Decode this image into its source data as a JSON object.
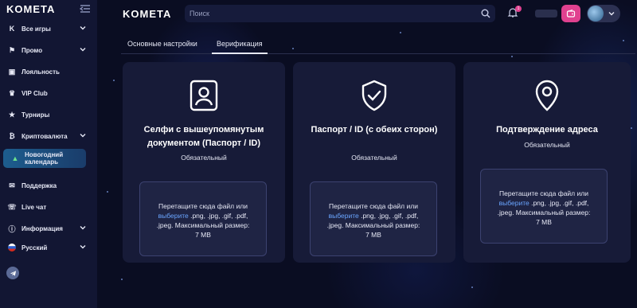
{
  "sidebar": {
    "logo_main": "KOMETA",
    "items": [
      {
        "label": "Все игры",
        "icon": "kometa-icon"
      },
      {
        "label": "Промо",
        "icon": "megaphone-icon"
      },
      {
        "label": "Лояльность",
        "icon": "loyalty-icon"
      },
      {
        "label": "VIP Club",
        "icon": "crown-icon"
      },
      {
        "label": "Турниры",
        "icon": "trophy-icon"
      },
      {
        "label": "Криптовалюта",
        "icon": "crypto-icon"
      },
      {
        "label": "Новогодний календарь",
        "icon": "tree-icon"
      },
      {
        "label": "Поддержка",
        "icon": "support-icon"
      },
      {
        "label": "Live чат",
        "icon": "headset-icon"
      },
      {
        "label": "Информация",
        "icon": "info-icon"
      },
      {
        "label": "Русский",
        "icon": "russian-flag-icon"
      }
    ]
  },
  "header": {
    "logo": "KOMETA",
    "search_placeholder": "Поиск",
    "notifications_count": "1"
  },
  "tabs": [
    {
      "label": "Основные настройки",
      "active": false
    },
    {
      "label": "Верификация",
      "active": true
    }
  ],
  "cards": [
    {
      "title": "Селфи с вышеупомянутым документом (Паспорт / ID)",
      "required": "Обязательный",
      "drop_line1": "Перетащите сюда файл или",
      "drop_link": "выберите",
      "drop_line2": " .png, .jpg, .gif, .pdf,",
      "drop_line3": ".jpeg. Максимальный размер:",
      "drop_line4": "7 MB"
    },
    {
      "title": "Паспорт / ID (с обеих сторон)",
      "required": "Обязательный",
      "drop_line1": "Перетащите сюда файл или",
      "drop_link": "выберите",
      "drop_line2": " .png, .jpg, .gif, .pdf,",
      "drop_line3": ".jpeg. Максимальный размер:",
      "drop_line4": "7 MB"
    },
    {
      "title": "Подтверждение адреса",
      "required": "Обязательный",
      "drop_line1": "Перетащите сюда файл или",
      "drop_link": "выберите",
      "drop_line2": " .png, .jpg, .gif, .pdf,",
      "drop_line3": ".jpeg. Максимальный размер:",
      "drop_line4": "7 MB"
    }
  ],
  "colors": {
    "accent": "#4fb3ff",
    "pink": "#e0418f",
    "link": "#6aa5ff"
  }
}
